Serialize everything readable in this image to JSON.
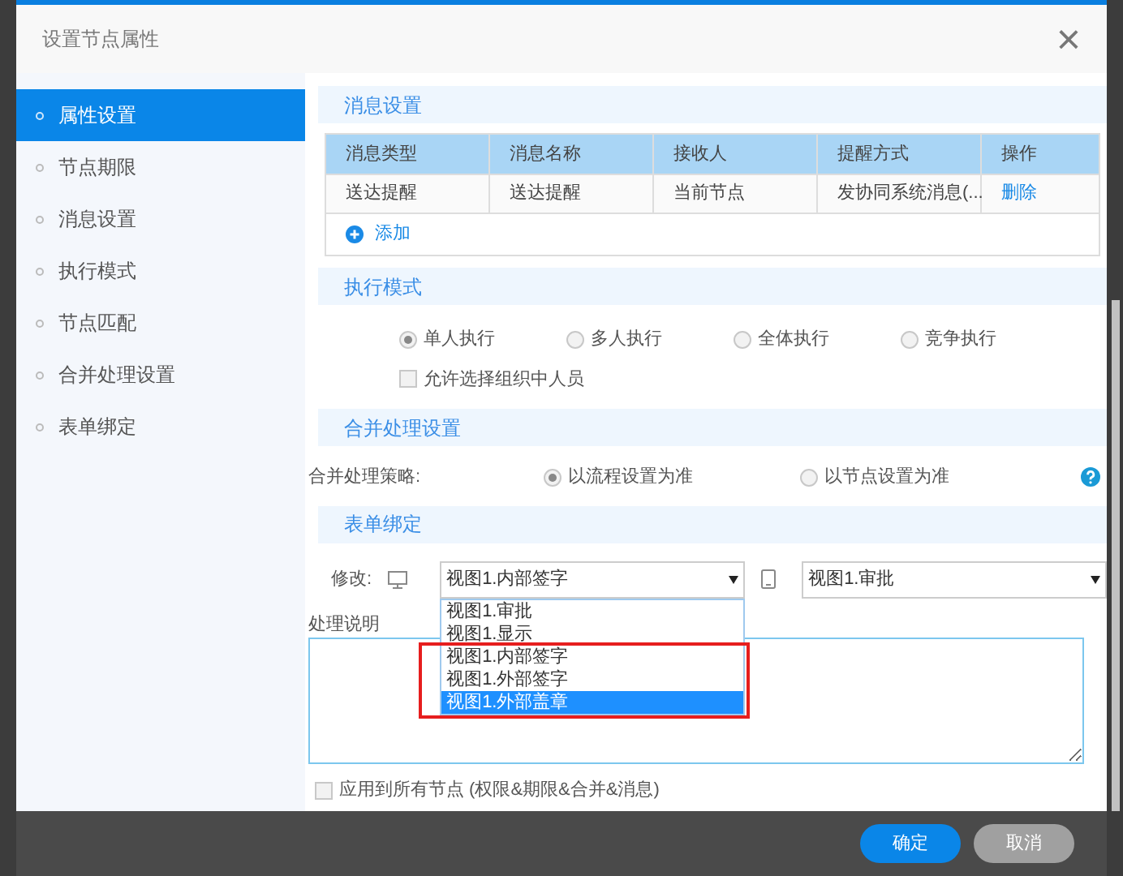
{
  "dialog": {
    "title": "设置节点属性",
    "close": "×"
  },
  "sidebar": {
    "items": [
      {
        "label": "属性设置",
        "selected": true
      },
      {
        "label": "节点期限",
        "selected": false
      },
      {
        "label": "消息设置",
        "selected": false
      },
      {
        "label": "执行模式",
        "selected": false
      },
      {
        "label": "节点匹配",
        "selected": false
      },
      {
        "label": "合并处理设置",
        "selected": false
      },
      {
        "label": "表单绑定",
        "selected": false
      }
    ]
  },
  "message_settings": {
    "title": "消息设置",
    "columns": [
      "消息类型",
      "消息名称",
      "接收人",
      "提醒方式",
      "操作"
    ],
    "rows": [
      {
        "cells": [
          "送达提醒",
          "送达提醒",
          "当前节点",
          "发协同系统消息(..."
        ],
        "action": "删除"
      }
    ],
    "add": "添加"
  },
  "execution_mode": {
    "title": "执行模式",
    "options": [
      {
        "label": "单人执行",
        "selected": true
      },
      {
        "label": "多人执行",
        "selected": false
      },
      {
        "label": "全体执行",
        "selected": false
      },
      {
        "label": "竞争执行",
        "selected": false
      }
    ],
    "allow_org": {
      "label": "允许选择组织中人员",
      "checked": false
    }
  },
  "merge_settings": {
    "title": "合并处理设置",
    "strategy_label": "合并处理策略:",
    "options": [
      {
        "label": "以流程设置为准",
        "selected": true
      },
      {
        "label": "以节点设置为准",
        "selected": false
      }
    ]
  },
  "form_binding": {
    "title": "表单绑定",
    "modify_label": "修改:",
    "pc_view": "视图1.内部签字",
    "mobile_view": "视图1.审批",
    "dropdown_options": [
      {
        "label": "视图1.审批",
        "selected": false
      },
      {
        "label": "视图1.显示",
        "selected": false
      },
      {
        "label": "视图1.内部签字",
        "selected": false
      },
      {
        "label": "视图1.外部签字",
        "selected": false
      },
      {
        "label": "视图1.外部盖章",
        "selected": true
      }
    ],
    "note_label": "处理说明",
    "apply_all": {
      "label": "应用到所有节点 (权限&期限&合并&消息)",
      "checked": false
    }
  },
  "buttons": {
    "ok": "确定",
    "cancel": "取消"
  }
}
